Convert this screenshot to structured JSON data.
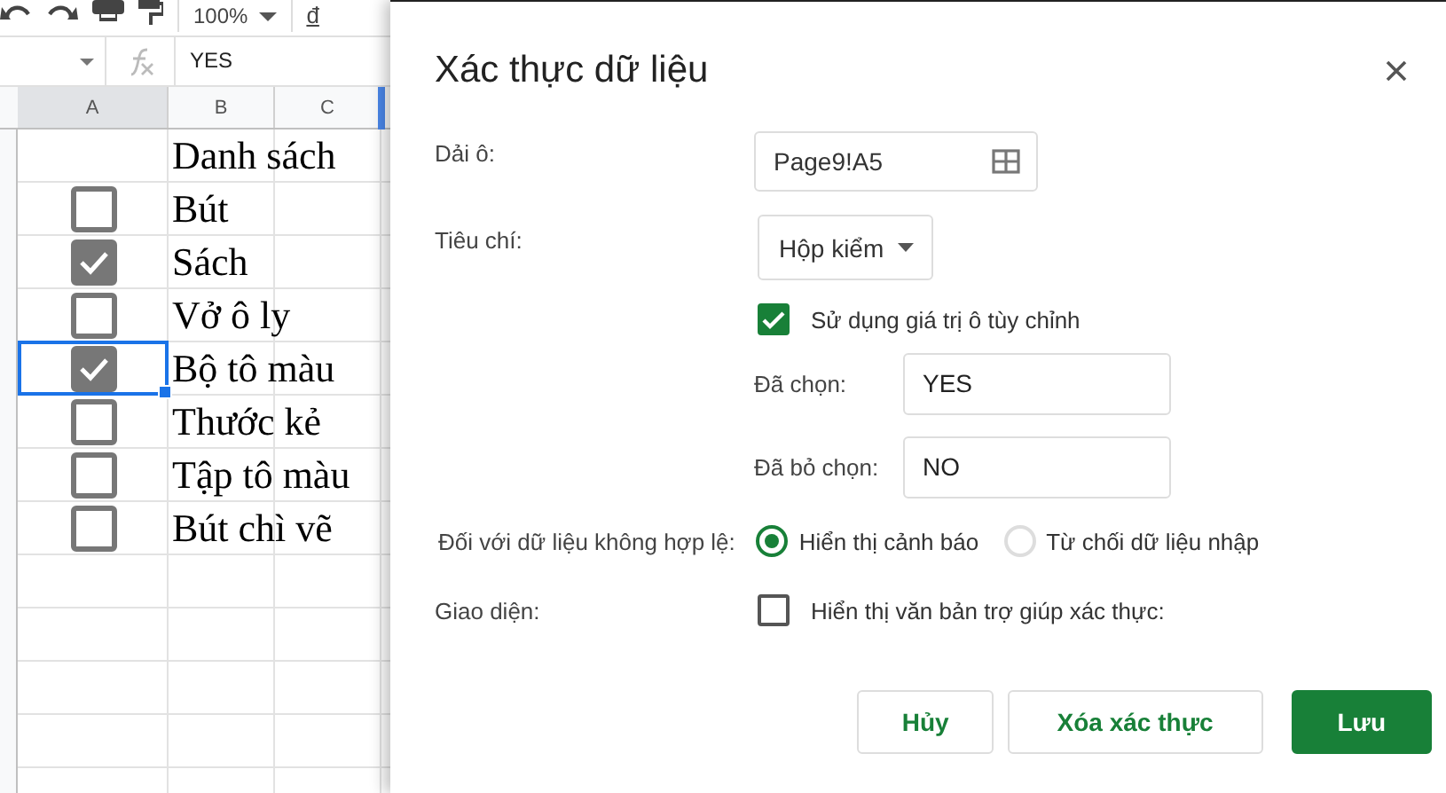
{
  "toolbar": {
    "zoom": "100%",
    "text_format": "đ"
  },
  "formula_bar": {
    "value": "YES"
  },
  "sheet": {
    "columns": [
      "A",
      "B",
      "C"
    ],
    "rows": [
      {
        "kind": "text",
        "text": "Danh sách",
        "selected": false
      },
      {
        "kind": "checkbox",
        "checked": false,
        "text": "Bút",
        "selected": false
      },
      {
        "kind": "checkbox",
        "checked": true,
        "text": "Sách",
        "selected": false
      },
      {
        "kind": "checkbox",
        "checked": false,
        "text": "Vở ô ly",
        "selected": false
      },
      {
        "kind": "checkbox",
        "checked": true,
        "text": "Bộ tô màu",
        "selected": true
      },
      {
        "kind": "checkbox",
        "checked": false,
        "text": "Thước kẻ",
        "selected": false
      },
      {
        "kind": "checkbox",
        "checked": false,
        "text": "Tập tô màu",
        "selected": false
      },
      {
        "kind": "checkbox",
        "checked": false,
        "text": "Bút chì vẽ",
        "selected": false
      }
    ]
  },
  "dialog": {
    "title": "Xác thực dữ liệu",
    "range": {
      "label": "Dải ô:",
      "value": "Page9!A5"
    },
    "criteria": {
      "label": "Tiêu chí:",
      "value": "Hộp kiểm"
    },
    "custom_values": {
      "label": "Sử dụng giá trị ô tùy chỉnh",
      "checked": true
    },
    "checked_value": {
      "label": "Đã chọn:",
      "value": "YES"
    },
    "unchecked_value": {
      "label": "Đã bỏ chọn:",
      "value": "NO"
    },
    "invalid_data": {
      "label": "Đối với dữ liệu không hợp lệ:",
      "options": [
        {
          "label": "Hiển thị cảnh báo",
          "selected": true
        },
        {
          "label": "Từ chối dữ liệu nhập",
          "selected": false
        }
      ]
    },
    "appearance": {
      "label": "Giao diện:",
      "help_text": {
        "label": "Hiển thị văn bản trợ giúp xác thực:",
        "checked": false
      }
    },
    "buttons": [
      {
        "label": "Hủy",
        "kind": "secondary"
      },
      {
        "label": "Xóa xác thực",
        "kind": "secondary"
      },
      {
        "label": "Lưu",
        "kind": "primary"
      }
    ]
  }
}
